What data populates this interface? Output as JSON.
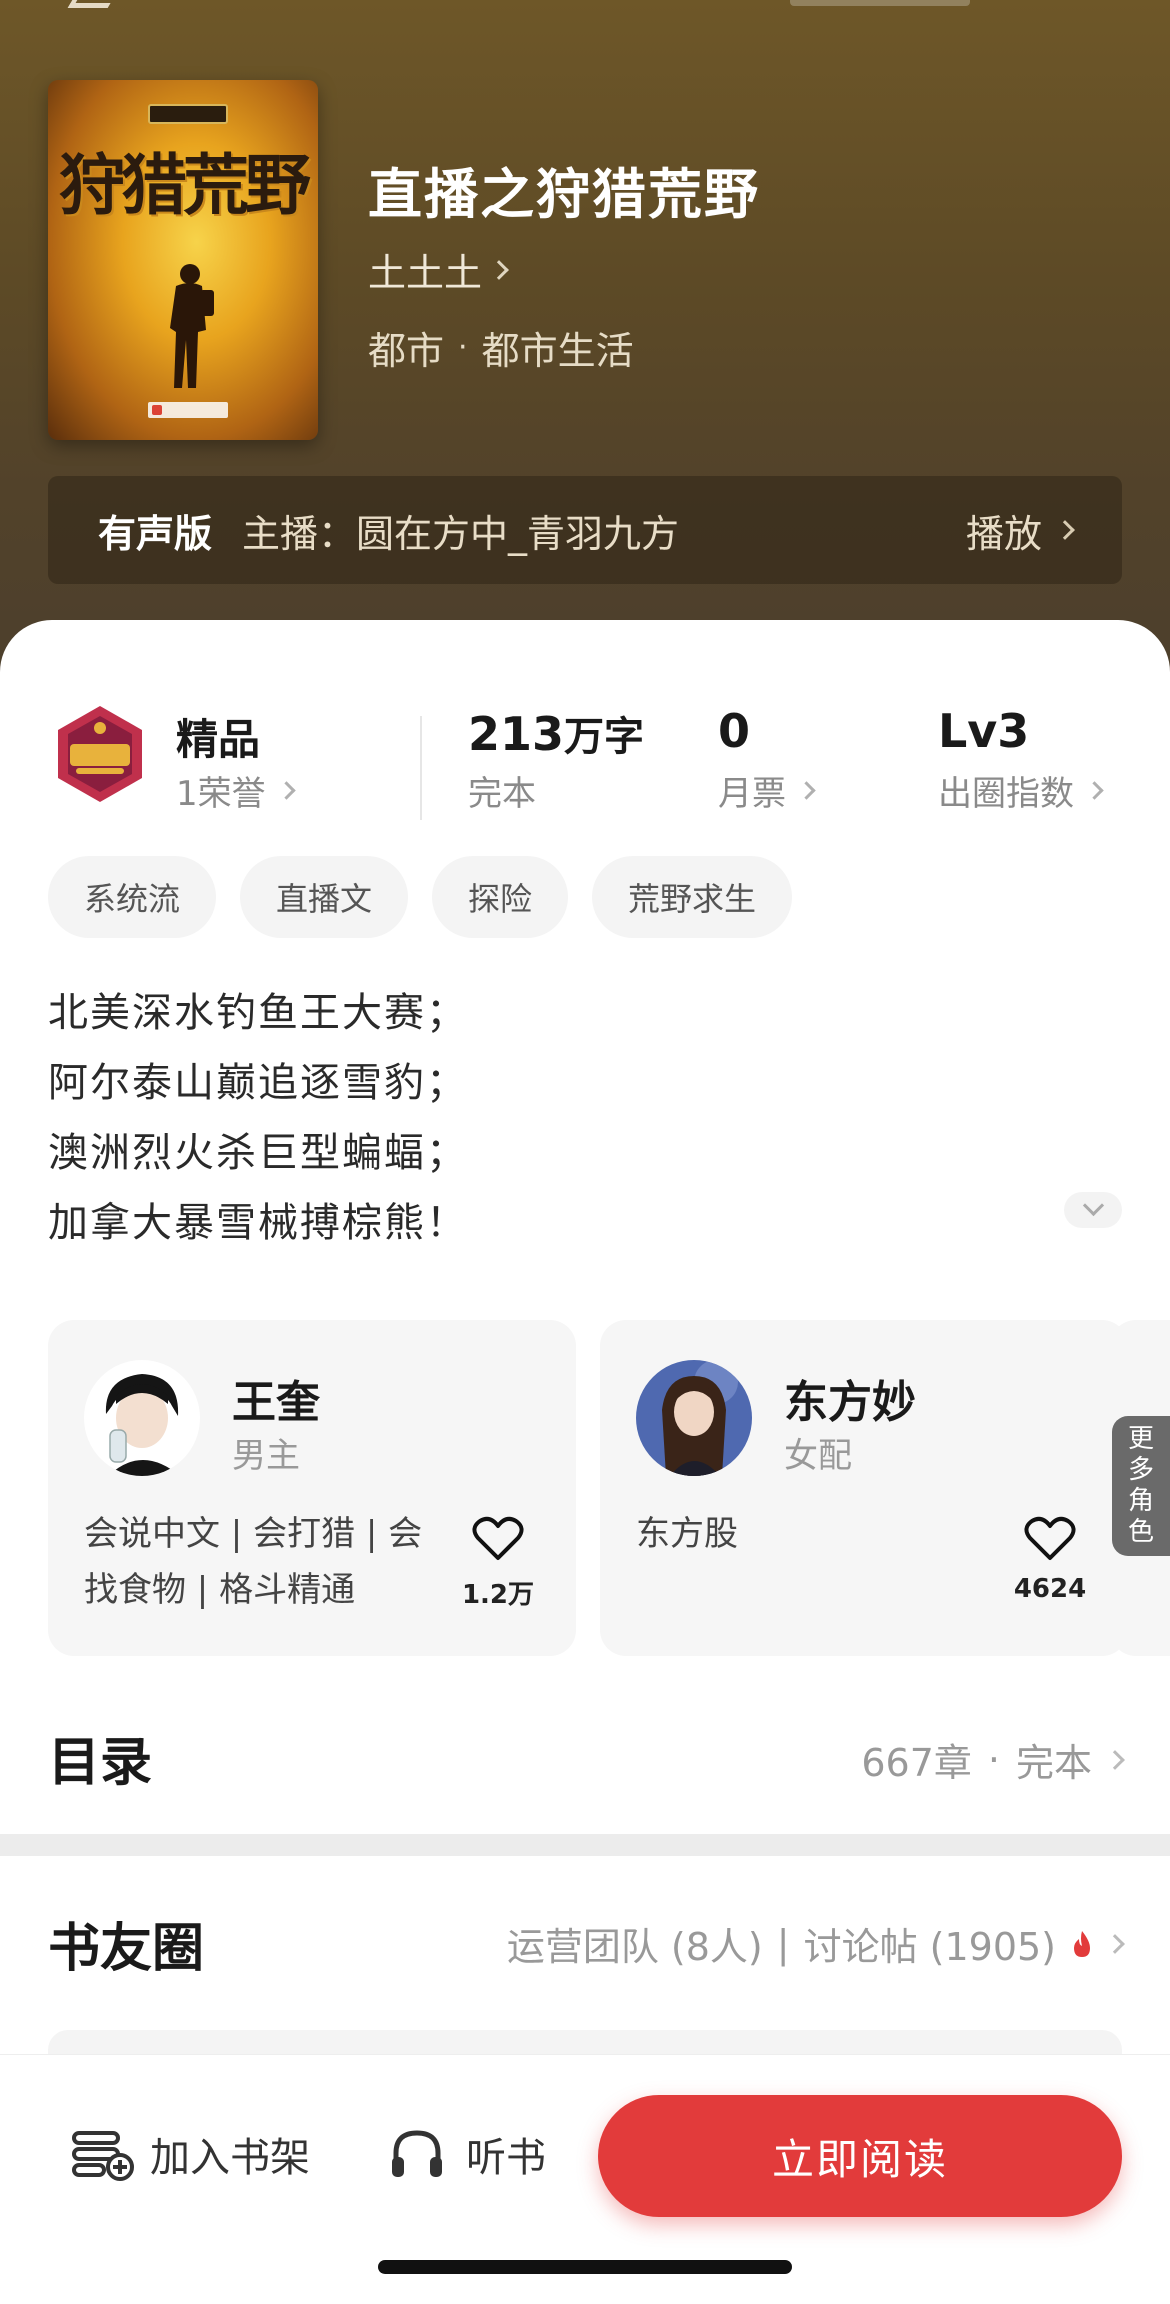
{
  "book": {
    "title": "直播之狩猎荒野",
    "author": "土土土",
    "genre": "都市",
    "subgenre": "都市生活",
    "genre_separator": "·",
    "cover_title": "狩猎荒野"
  },
  "audio": {
    "tag": "有声版",
    "host": "主播：圆在方中_青羽九方",
    "play_label": "播放"
  },
  "stats": {
    "quality_label": "精品",
    "honor": "1荣誉",
    "word_count_num": "213",
    "word_count_unit": "万字",
    "status": "完本",
    "monthly_votes": "0",
    "monthly_votes_label": "月票",
    "level": "Lv3",
    "level_label": "出圈指数"
  },
  "tags": [
    "系统流",
    "直播文",
    "探险",
    "荒野求生"
  ],
  "intro": [
    "北美深水钓鱼王大赛；",
    "阿尔泰山巅追逐雪豹；",
    "澳洲烈火杀巨型蝙蝠；",
    "加拿大暴雪械搏棕熊！"
  ],
  "characters": [
    {
      "name": "王奎",
      "role": "男主",
      "desc": "会说中文 | 会打猎 | 会找食物 | 格斗精通",
      "likes": "1.2万"
    },
    {
      "name": "东方妙",
      "role": "女配",
      "desc": "东方股",
      "likes": "4624"
    }
  ],
  "more_roles": [
    "更",
    "多",
    "角",
    "色"
  ],
  "catalog": {
    "title": "目录",
    "chapters": "667章",
    "separator": "·",
    "status": "完本"
  },
  "circle": {
    "title": "书友圈",
    "team": "运营团队 (8人)",
    "divider": "|",
    "posts": "讨论帖 (1905)"
  },
  "bottom": {
    "shelf_label": "加入书架",
    "listen_label": "听书",
    "read_label": "立即阅读"
  },
  "colors": {
    "accent": "#e23b3b",
    "header_bg": "#5d4a26"
  }
}
